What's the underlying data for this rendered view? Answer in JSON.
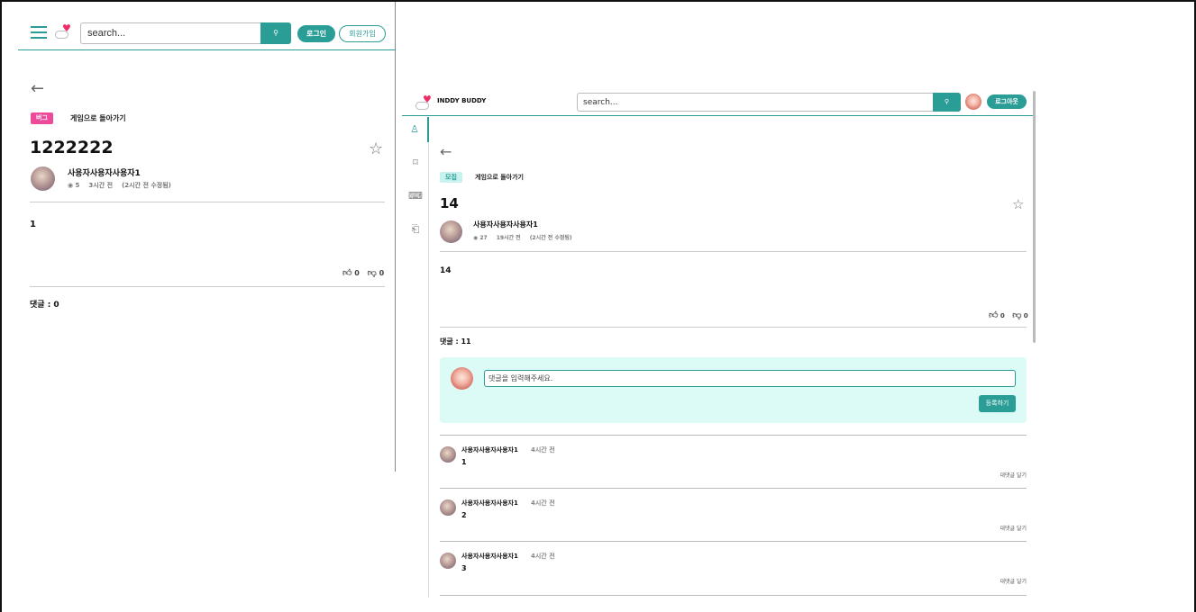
{
  "mobile": {
    "header": {
      "search_placeholder": "search...",
      "search_icon": "magnifier-icon",
      "login_label": "로그인",
      "signup_label": "회원가입"
    },
    "post": {
      "tag": "버그",
      "back_to_game": "게임으로 돌아가기",
      "title": "1222222",
      "author": "사용자사용자사용자1",
      "views": "◉ 5",
      "time": "3시간 전",
      "edited": "(2시간 전 수정됨)",
      "body": "1",
      "likes": "0",
      "dislikes": "0",
      "comment_count": "댓글 : 0"
    }
  },
  "desktop": {
    "header": {
      "brand": "INDDY BUDDY",
      "search_placeholder": "search...",
      "logout_label": "로그아웃"
    },
    "side_nav": [
      {
        "icon": "person-icon",
        "glyph": "♙"
      },
      {
        "icon": "bookmark-icon",
        "glyph": "⌑"
      },
      {
        "icon": "gamepad-icon",
        "glyph": "⌨"
      },
      {
        "icon": "chat-icon",
        "glyph": "⎗"
      }
    ],
    "post": {
      "tag": "모집",
      "back_to_game": "게임으로 돌아가기",
      "title": "14",
      "author": "사용자사용자사용자1",
      "views": "◉ 27",
      "time": "19시간 전",
      "edited": "(2시간 전 수정됨)",
      "body": "14",
      "likes": "0",
      "dislikes": "0",
      "comment_count": "댓글 : 11",
      "comment_placeholder": "댓글을 입력해주세요.",
      "submit_label": "등록하기"
    },
    "comments": [
      {
        "author": "사용자사용자사용자1",
        "time": "4시간 전",
        "text": "1",
        "reply": "대댓글 달기"
      },
      {
        "author": "사용자사용자사용자1",
        "time": "4시간 전",
        "text": "2",
        "reply": "대댓글 달기"
      },
      {
        "author": "사용자사용자사용자1",
        "time": "4시간 전",
        "text": "3",
        "reply": "대댓글 달기"
      }
    ]
  },
  "colors": {
    "accent": "#2a9d96",
    "bug_tag": "#ee4a9a",
    "recruit_tag": "#c8f2ee",
    "comment_box": "#dcfaf6",
    "heart": "#ee2e67"
  }
}
